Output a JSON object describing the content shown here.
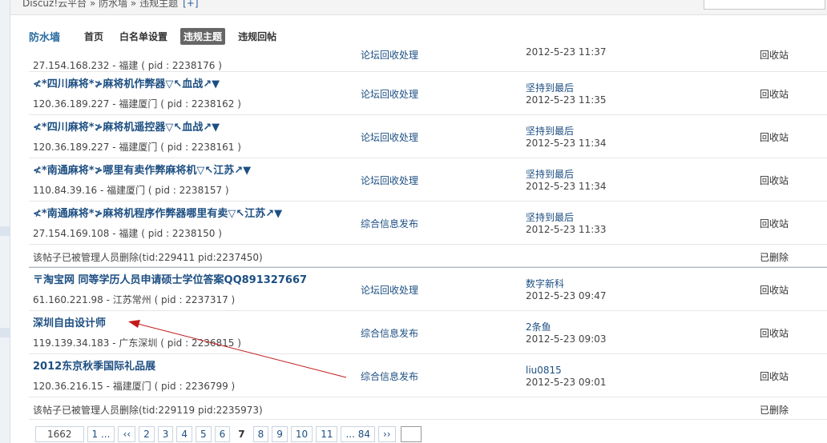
{
  "breadcrumb": {
    "text": "Discuz!云平台 » 防水墙 » 违规主题",
    "plus": "[+]"
  },
  "subnav": {
    "brand": "防水墙",
    "items": [
      "首页",
      "白名单设置",
      "违规主题",
      "违规回帖"
    ]
  },
  "rows": [
    {
      "meta": "27.154.168.232 - 福建 ( pid : 2238176 )",
      "forum": "论坛回收处理",
      "date": "2012-5-23 11:37",
      "status": "回收站"
    },
    {
      "title": "≮*四川麻将*≯麻将机作弊器▽↖血战↗▼",
      "meta": "120.36.189.227 - 福建厦门 ( pid : 2238162 )",
      "forum": "论坛回收处理",
      "author": "坚持到最后",
      "date": "2012-5-23 11:35",
      "status": "回收站"
    },
    {
      "title": "≮*四川麻将*≯麻将机遥控器▽↖血战↗▼",
      "meta": "120.36.189.227 - 福建厦门 ( pid : 2238161 )",
      "forum": "论坛回收处理",
      "author": "坚持到最后",
      "date": "2012-5-23 11:34",
      "status": "回收站"
    },
    {
      "title": "≮*南通麻将*≯哪里有卖作弊麻将机▽↖江苏↗▼",
      "meta": "110.84.39.16 - 福建厦门 ( pid : 2238157 )",
      "forum": "论坛回收处理",
      "author": "坚持到最后",
      "date": "2012-5-23 11:34",
      "status": "回收站"
    },
    {
      "title": "≮*南通麻将*≯麻将机程序作弊器哪里有卖▽↖江苏↗▼",
      "meta": "27.154.169.108 - 福建 ( pid : 2238150 )",
      "forum": "综合信息发布",
      "author": "坚持到最后",
      "date": "2012-5-23 11:33",
      "status": "回收站"
    },
    {
      "deleted_text": "该帖子已被管理人员删除(tid:229411 pid:2237450)",
      "status": "已删除"
    },
    {
      "title": "〒淘宝网 同等学历人员申请硕士学位答案QQ891327667",
      "meta": "61.160.221.98 - 江苏常州 ( pid : 2237317 )",
      "forum": "论坛回收处理",
      "author": "数字新科",
      "date": "2012-5-23 09:47",
      "status": "回收站"
    },
    {
      "title": "深圳自由设计师",
      "meta": "119.139.34.183 - 广东深圳 ( pid : 2236815 )",
      "forum": "综合信息发布",
      "author": "2条鱼",
      "date": "2012-5-23 09:03",
      "status": "回收站"
    },
    {
      "title": "2012东京秋季国际礼品展",
      "meta": "120.36.216.15 - 福建厦门 ( pid : 2236799 )",
      "forum": "综合信息发布",
      "author": "liu0815",
      "date": "2012-5-23 09:01",
      "status": "回收站"
    },
    {
      "deleted_text": "该帖子已被管理人员删除(tid:229119 pid:2235973)",
      "status": "已删除"
    }
  ],
  "pager": {
    "count": "1662",
    "items": [
      "1 ...",
      "‹‹",
      "2",
      "3",
      "4",
      "5",
      "6",
      "7",
      "8",
      "9",
      "10",
      "11",
      "... 84",
      "››"
    ],
    "current": "7"
  },
  "colors": {
    "link": "#1d4f82",
    "brand": "#2b6c9f",
    "arrow": "#c41a1a"
  }
}
